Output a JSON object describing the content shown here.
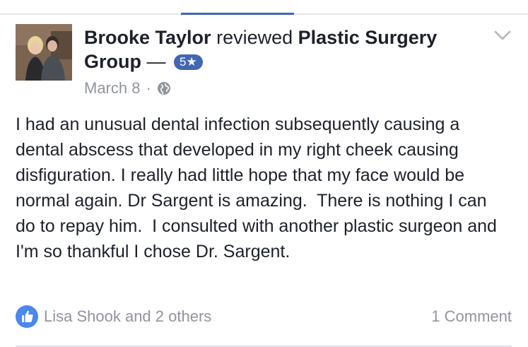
{
  "review": {
    "reviewer_name": "Brooke Taylor",
    "action_text": "reviewed",
    "page_name": "Plastic Surgery Group",
    "separator": "—",
    "rating": "5★",
    "date": "March 8",
    "meta_dot": "·",
    "body": "I had an unusual dental infection subsequently causing a dental abscess that developed in my right cheek causing disfiguration. I really had little hope that my face would be normal again. Dr Sargent is amazing.  There is nothing I can do to repay him.  I consulted with another plastic surgeon and I'm so thankful I chose Dr. Sargent."
  },
  "footer": {
    "likes_text": "Lisa Shook and 2 others",
    "comments_text": "1 Comment"
  },
  "icons": {
    "like": "thumbs-up-icon",
    "privacy": "globe-icon",
    "menu": "chevron-down-icon"
  },
  "colors": {
    "brand": "#4267b2",
    "secondary_text": "#90949c",
    "primary_text": "#1d2129"
  }
}
